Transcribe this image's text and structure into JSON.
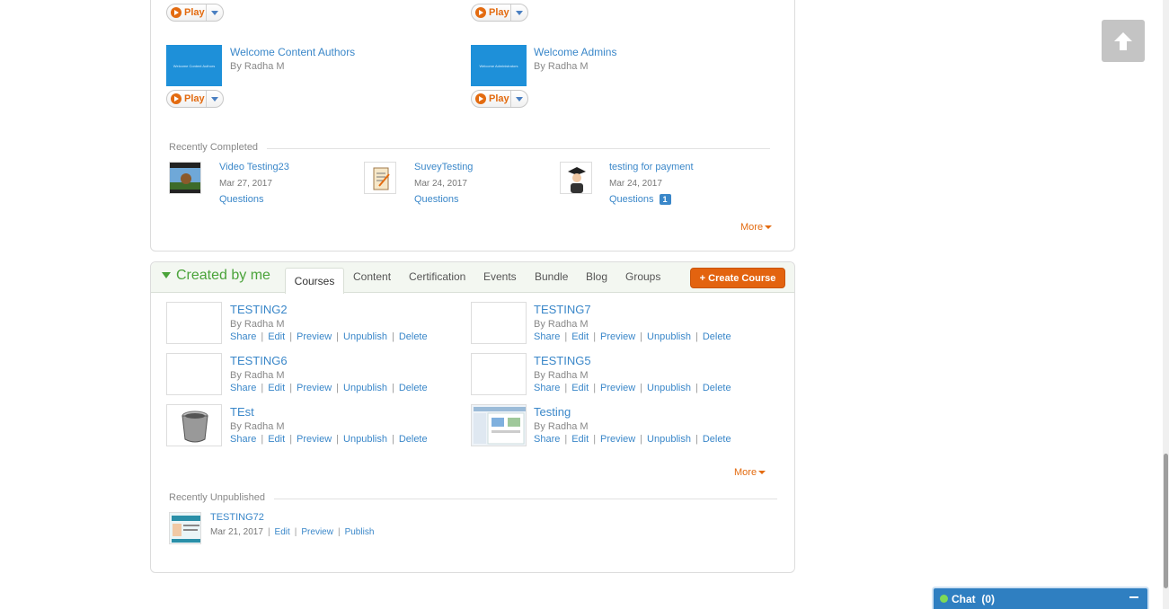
{
  "top_items": [
    {
      "play": "Play"
    },
    {
      "play": "Play"
    },
    {
      "title": "Welcome Content Authors",
      "author": "By Radha M",
      "thumb_text": "Welcome Content Authors",
      "play": "Play"
    },
    {
      "title": "Welcome Admins",
      "author": "By Radha M",
      "thumb_text": "Welcome Administrators",
      "play": "Play"
    }
  ],
  "recently_completed": {
    "label": "Recently Completed",
    "items": [
      {
        "title": "Video Testing23",
        "date": "Mar 27, 2017",
        "questions": "Questions",
        "badge": ""
      },
      {
        "title": "SuveyTesting",
        "date": "Mar 24, 2017",
        "questions": "Questions",
        "badge": ""
      },
      {
        "title": "testing for payment",
        "date": "Mar 24, 2017",
        "questions": "Questions",
        "badge": "1"
      }
    ],
    "more": "More"
  },
  "created_by_me": {
    "title": "Created by me",
    "tabs": [
      "Courses",
      "Content",
      "Certification",
      "Events",
      "Bundle",
      "Blog",
      "Groups"
    ],
    "active_tab": "Courses",
    "create_button": "+ Create Course",
    "courses": [
      {
        "title": "TESTING2",
        "author": "By Radha M"
      },
      {
        "title": "TESTING7",
        "author": "By Radha M"
      },
      {
        "title": "TESTING6",
        "author": "By Radha M"
      },
      {
        "title": "TESTING5",
        "author": "By Radha M"
      },
      {
        "title": "TEst",
        "author": "By Radha M"
      },
      {
        "title": "Testing",
        "author": "By Radha M"
      }
    ],
    "actions": {
      "share": "Share",
      "edit": "Edit",
      "preview": "Preview",
      "unpublish": "Unpublish",
      "delete": "Delete",
      "sep": "|"
    },
    "more": "More"
  },
  "recently_unpublished": {
    "label": "Recently Unpublished",
    "items": [
      {
        "title": "TESTING72",
        "date": "Mar 21, 2017",
        "edit": "Edit",
        "preview": "Preview",
        "publish": "Publish",
        "sep": "|"
      }
    ]
  },
  "chat": {
    "label": "Chat",
    "count": "(0)"
  }
}
